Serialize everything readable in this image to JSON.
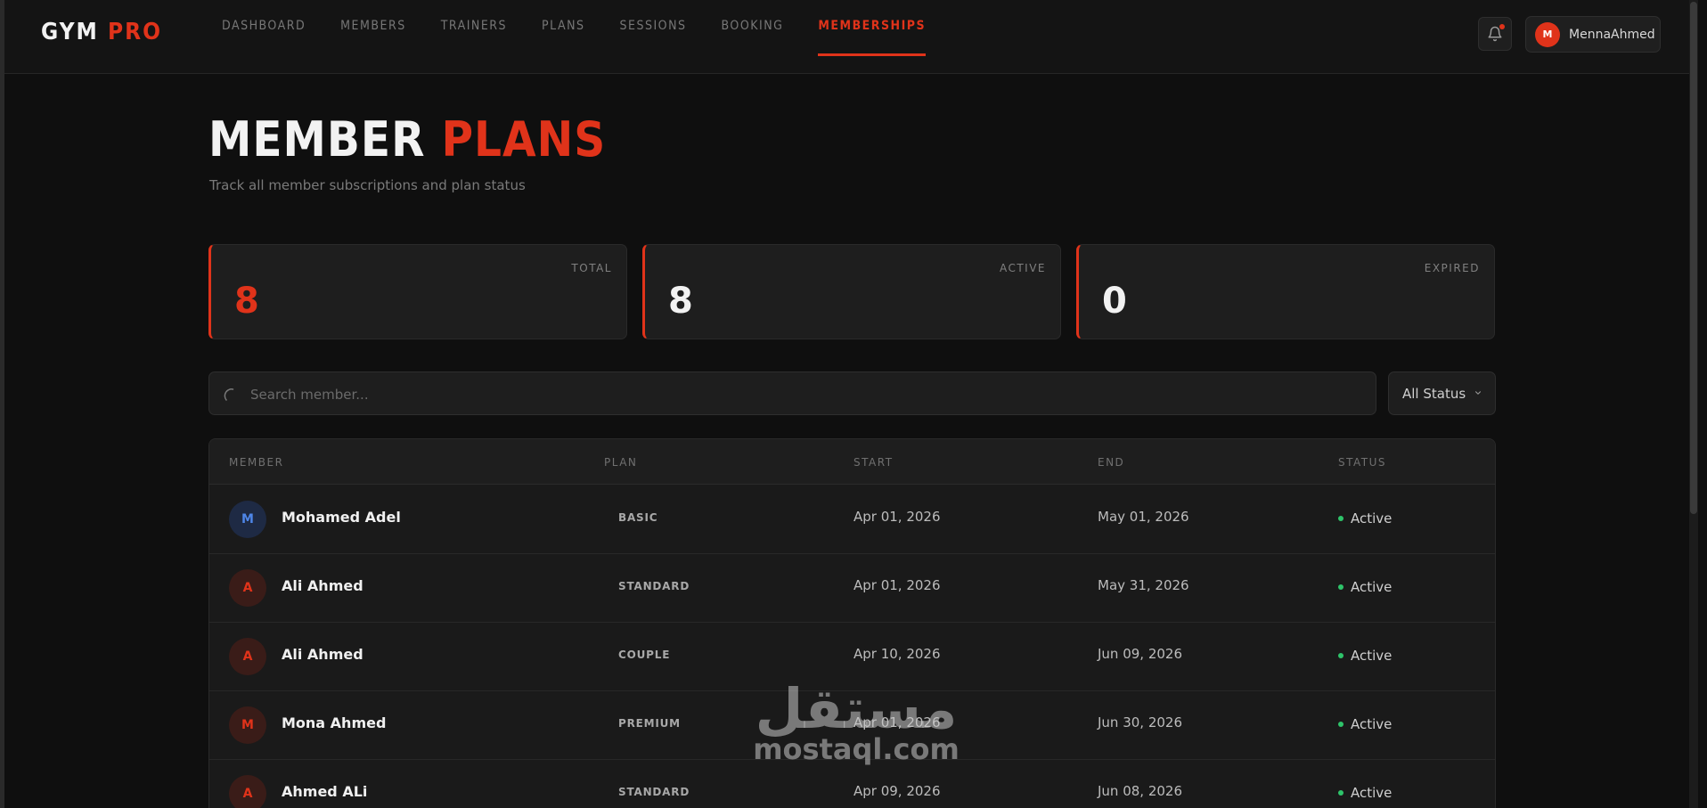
{
  "brand": {
    "part1": "GYM",
    "part2": "PRO"
  },
  "nav": [
    {
      "label": "DASHBOARD"
    },
    {
      "label": "MEMBERS"
    },
    {
      "label": "TRAINERS"
    },
    {
      "label": "PLANS"
    },
    {
      "label": "SESSIONS"
    },
    {
      "label": "BOOKING"
    },
    {
      "label": "MEMBERSHIPS",
      "active": true
    }
  ],
  "user": {
    "initial": "M",
    "name": "MennaAhmed"
  },
  "page": {
    "title_part1": "MEMBER",
    "title_part2": "PLANS",
    "subtitle": "Track all member subscriptions and plan status"
  },
  "stats": [
    {
      "label": "TOTAL",
      "value": "8"
    },
    {
      "label": "ACTIVE",
      "value": "8"
    },
    {
      "label": "EXPIRED",
      "value": "0"
    }
  ],
  "search": {
    "placeholder": "Search member..."
  },
  "filter": {
    "selected": "All Status"
  },
  "table": {
    "columns": [
      "MEMBER",
      "PLAN",
      "START",
      "END",
      "STATUS"
    ],
    "rows": [
      {
        "initial": "M",
        "name": "Mohamed Adel",
        "plan": "BASIC",
        "start": "Apr 01, 2026",
        "end": "May 01, 2026",
        "status": "Active"
      },
      {
        "initial": "A",
        "name": "Ali Ahmed",
        "plan": "STANDARD",
        "start": "Apr 01, 2026",
        "end": "May 31, 2026",
        "status": "Active"
      },
      {
        "initial": "A",
        "name": "Ali Ahmed",
        "plan": "COUPLE",
        "start": "Apr 10, 2026",
        "end": "Jun 09, 2026",
        "status": "Active"
      },
      {
        "initial": "M",
        "name": "Mona Ahmed",
        "plan": "PREMIUM",
        "start": "Apr 01, 2026",
        "end": "Jun 30, 2026",
        "status": "Active"
      },
      {
        "initial": "A",
        "name": "Ahmed ALi",
        "plan": "STANDARD",
        "start": "Apr 09, 2026",
        "end": "Jun 08, 2026",
        "status": "Active"
      }
    ]
  },
  "watermark": {
    "arabic": "مستقل",
    "latin": "mostaql.com"
  },
  "colors": {
    "accent": "#e0331a",
    "background": "#0f0f0f",
    "success": "#2ec46a",
    "avatar_blue": "#4e86e8"
  }
}
